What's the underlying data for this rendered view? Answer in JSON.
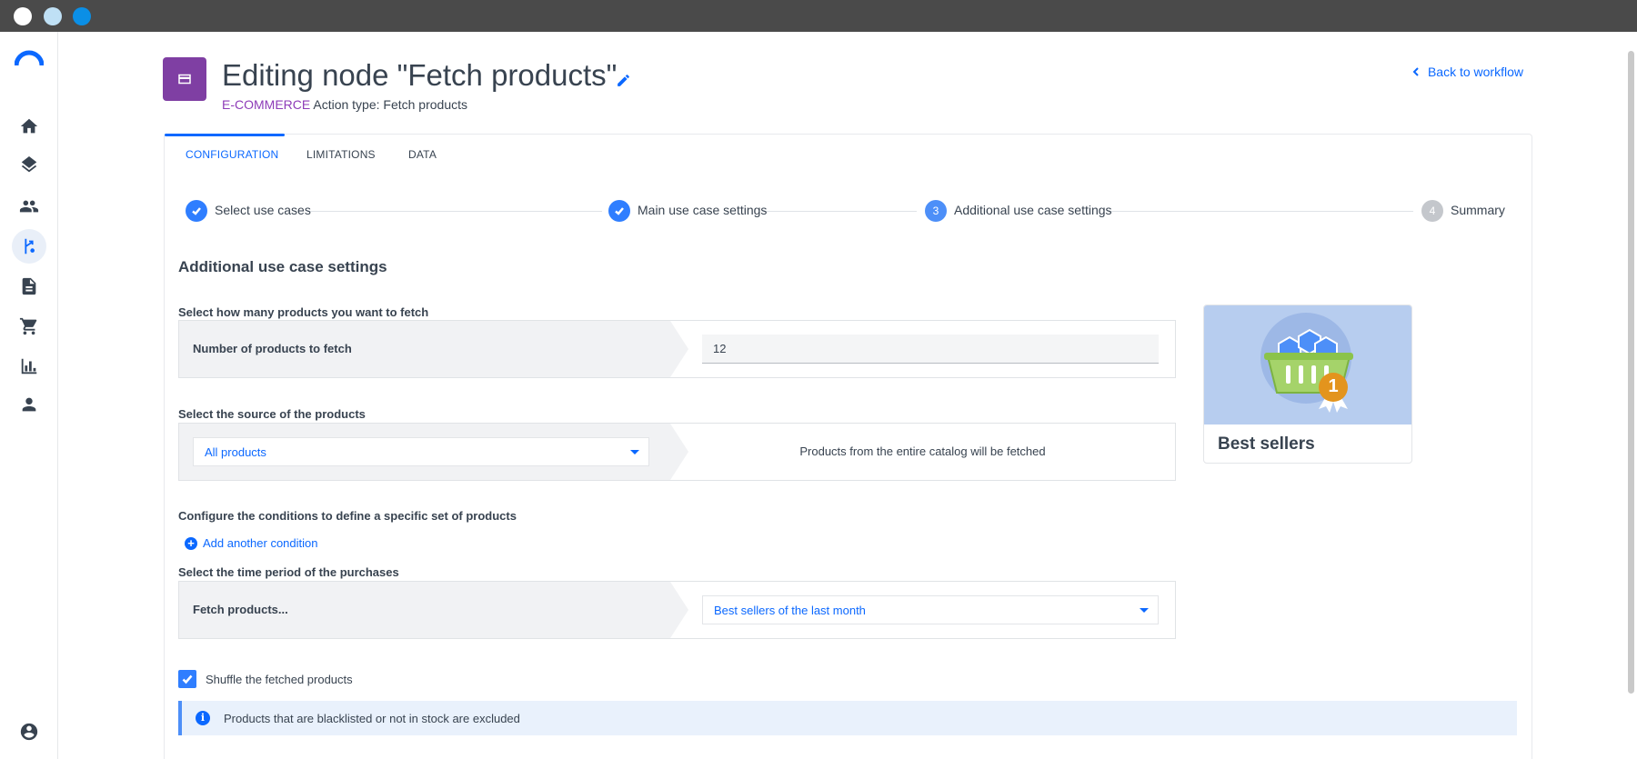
{
  "header": {
    "title": "Editing node \"Fetch products\"",
    "category": "E-COMMERCE",
    "action_type": "Action type: Fetch products",
    "back_link": "Back to workflow"
  },
  "tabs": [
    {
      "label": "CONFIGURATION",
      "active": true
    },
    {
      "label": "LIMITATIONS",
      "active": false
    },
    {
      "label": "DATA",
      "active": false
    }
  ],
  "stepper": [
    {
      "label": "Select use cases",
      "status": "done"
    },
    {
      "label": "Main use case settings",
      "status": "done"
    },
    {
      "label": "Additional use case settings",
      "status": "current",
      "number": "3"
    },
    {
      "label": "Summary",
      "status": "pending",
      "number": "4"
    }
  ],
  "section_title": "Additional use case settings",
  "quantity": {
    "label": "Select how many products you want to fetch",
    "row_label": "Number of products to fetch",
    "value": "12"
  },
  "source": {
    "label": "Select the source of the products",
    "selected": "All products",
    "description": "Products from the entire catalog will be fetched"
  },
  "conditions": {
    "label": "Configure the conditions to define a specific set of products",
    "add_label": "Add another condition"
  },
  "period": {
    "label": "Select the time period of the purchases",
    "row_label": "Fetch products...",
    "selected": "Best sellers of the last month"
  },
  "shuffle": {
    "label": "Shuffle the fetched products",
    "checked": true
  },
  "info": {
    "text": "Products that are blacklisted or not in stock are excluded"
  },
  "use_case_card": {
    "title": "Best sellers",
    "badge": "1"
  },
  "sidebar": {
    "items": [
      {
        "icon": "home-icon"
      },
      {
        "icon": "layers-icon"
      },
      {
        "icon": "people-icon"
      },
      {
        "icon": "workflow-icon",
        "active": true
      },
      {
        "icon": "document-icon"
      },
      {
        "icon": "cart-icon"
      },
      {
        "icon": "chart-icon"
      },
      {
        "icon": "person-icon"
      },
      {
        "icon": "account-icon"
      }
    ]
  },
  "colors": {
    "accent": "#0b68ff",
    "category": "#8e3cb8",
    "node_icon": "#7f3fa3"
  }
}
